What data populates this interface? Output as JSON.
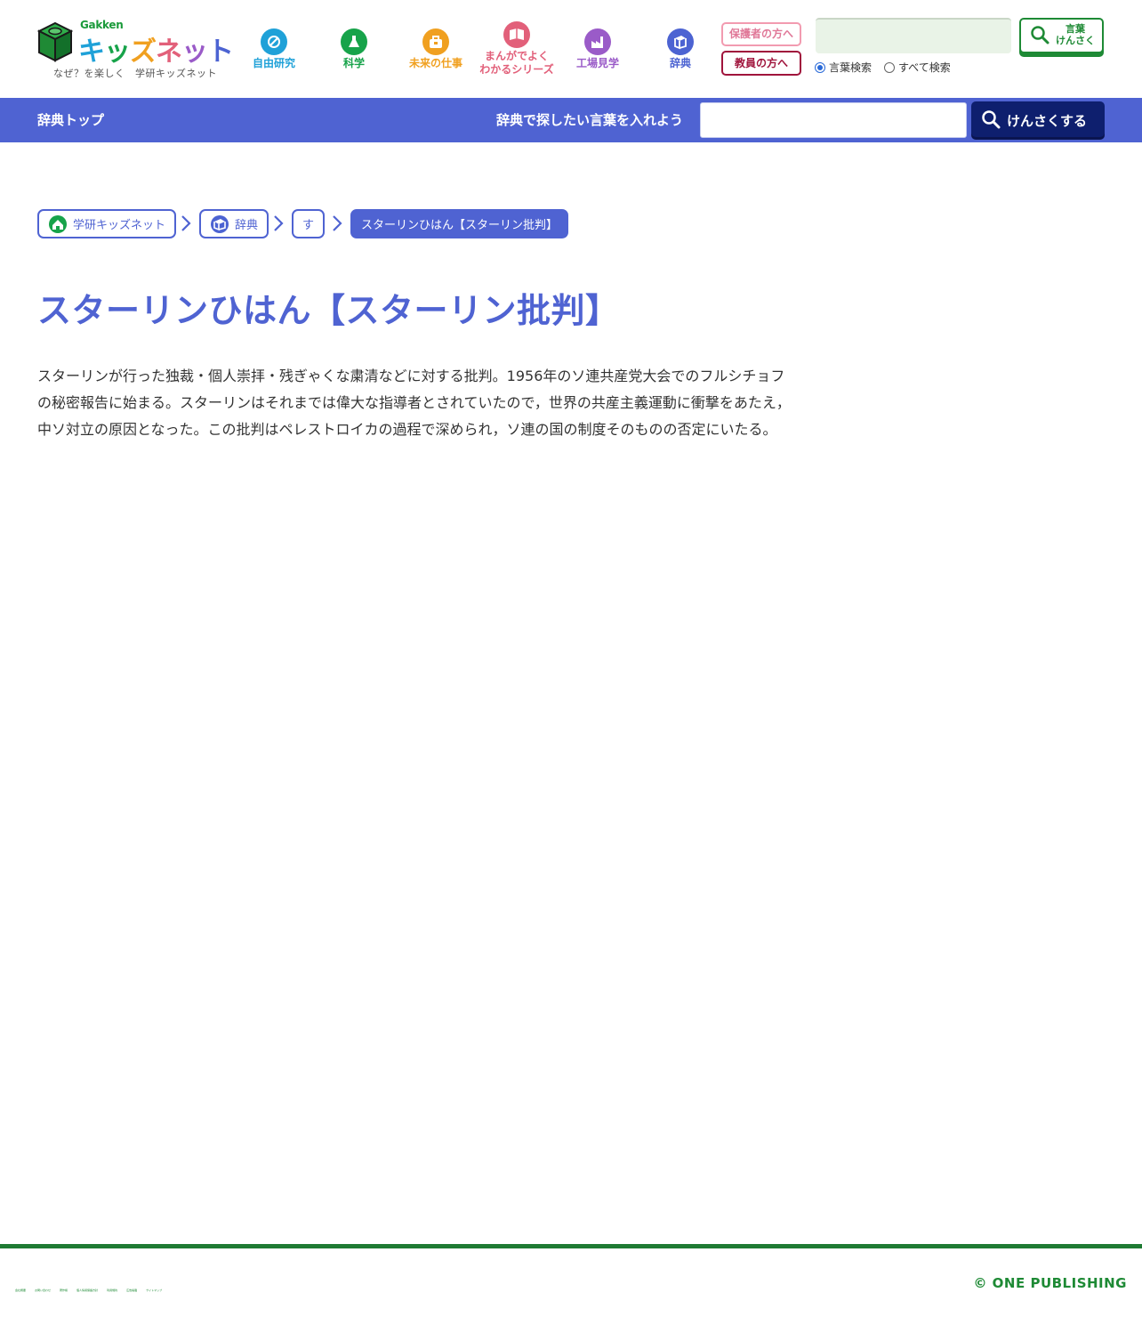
{
  "header": {
    "logo": {
      "brand": "Gakken",
      "name_parts": [
        "キ",
        "ッ",
        "ズ",
        "ネ",
        "ッ",
        "ト"
      ],
      "tagline": "なぜ？を楽しく　学研キッズネット"
    },
    "nav": [
      {
        "label": "自由研究",
        "icon": "free-research-icon",
        "color": "#1fa1d8"
      },
      {
        "label": "科学",
        "icon": "science-flask-icon",
        "color": "#17a34a"
      },
      {
        "label": "未来の仕事",
        "icon": "briefcase-icon",
        "color": "#f0a020"
      },
      {
        "label_line1": "まんがでよく",
        "label_line2": "わかるシリーズ",
        "icon": "manga-book-icon",
        "color": "#e2607a"
      },
      {
        "label": "工場見学",
        "icon": "factory-icon",
        "color": "#9a5bc8"
      },
      {
        "label": "辞典",
        "icon": "dictionary-icon",
        "color": "#4c63d2"
      }
    ],
    "parent_button": "保護者の方へ",
    "teacher_button": "教員の方へ",
    "search": {
      "placeholder": "",
      "button_line1": "言葉",
      "button_line2": "けんさく",
      "radio_options": [
        "言葉検索",
        "すべて検索"
      ],
      "selected": "言葉検索"
    }
  },
  "dict_bar": {
    "top_link": "辞典トップ",
    "prompt": "辞典で探したい言葉を入れよう",
    "input_placeholder": "",
    "button_label": "けんさくする"
  },
  "breadcrumb": [
    "学研キッズネット",
    "辞典",
    "す",
    "スターリンひはん【スターリン批判】"
  ],
  "entry": {
    "title": "スターリンひはん【スターリン批判】",
    "body_plain": "スターリンが行った独裁・個人崇拝・残ぎゃくな粛清などに対する批判。1956年のソ連共産党大会でのフルシチョフの秘密報告に始まる。スターリンはそれまでは偉大な指導者とされていたので，世界の共産主義運動に衝撃をあたえ，中ソ対立の原因となった。この批判はペレストロイカの過程で深められ，ソ連の国の制度そのものの否定にいたる。"
  },
  "footer": {
    "links": [
      "会社概要",
      "お問い合わせ",
      "著作権",
      "個人情報保護方針",
      "利用規約",
      "広告掲載",
      "サイトマップ"
    ],
    "copyright": "© ONE PUBLISHING"
  },
  "colors": {
    "brand_blue": "#4f63d2",
    "dark_navy": "#0e1f6e",
    "footer_green": "#1e7a33",
    "teacher_red": "#a0143c",
    "parent_pink": "#f29bb0"
  }
}
